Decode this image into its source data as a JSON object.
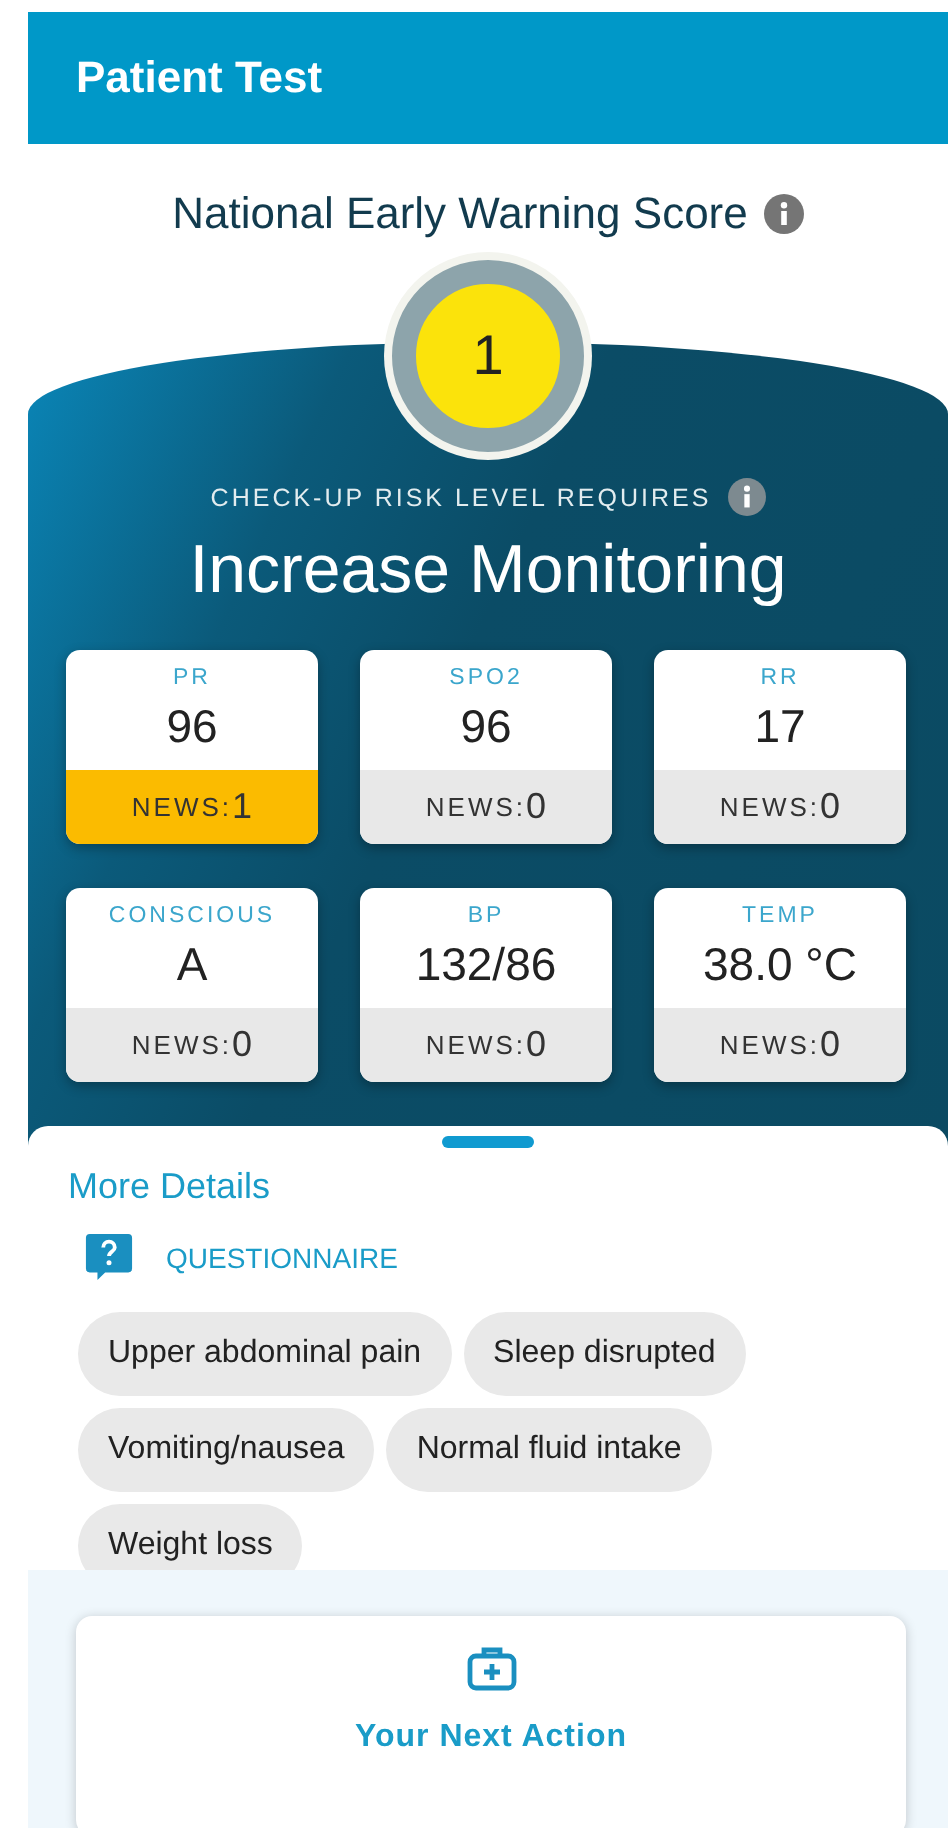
{
  "app_bar": {
    "title": "Patient Test"
  },
  "score": {
    "title": "National Early Warning Score",
    "value": "1",
    "caption": "CHECK-UP RISK LEVEL REQUIRES",
    "action": "Increase Monitoring"
  },
  "vitals": [
    {
      "label": "PR",
      "value": "96",
      "news_label": "NEWS:",
      "news": "1",
      "alert": true
    },
    {
      "label": "SPO2",
      "value": "96",
      "news_label": "NEWS:",
      "news": "0",
      "alert": false
    },
    {
      "label": "RR",
      "value": "17",
      "news_label": "NEWS:",
      "news": "0",
      "alert": false
    },
    {
      "label": "CONSCIOUS",
      "value": "A",
      "news_label": "NEWS:",
      "news": "0",
      "alert": false
    },
    {
      "label": "BP",
      "value": "132/86",
      "news_label": "NEWS:",
      "news": "0",
      "alert": false
    },
    {
      "label": "TEMP",
      "value": "38.0 °C",
      "news_label": "NEWS:",
      "news": "0",
      "alert": false
    }
  ],
  "details": {
    "title": "More Details",
    "section": "QUESTIONNAIRE",
    "chips": [
      "Upper abdominal pain",
      "Sleep disrupted",
      "Vomiting/nausea",
      "Normal fluid intake",
      "Weight loss"
    ]
  },
  "next_action": {
    "label": "Your Next Action"
  }
}
